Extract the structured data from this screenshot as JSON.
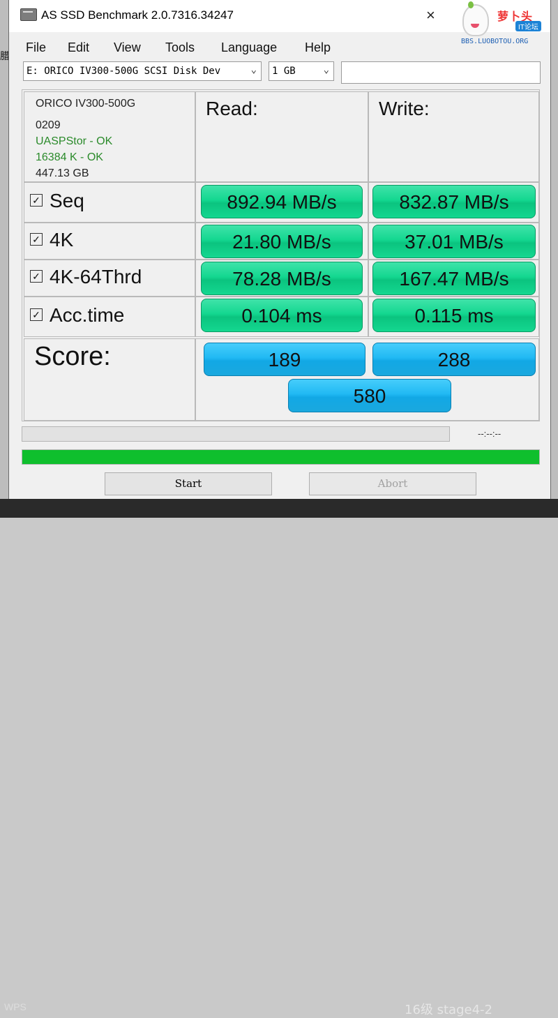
{
  "window": {
    "title": "AS SSD Benchmark 2.0.7316.34247"
  },
  "watermark": {
    "name_cn": "萝卜头",
    "sub_cn": "IT论坛",
    "url": "BBS.LUOBOTOU.ORG"
  },
  "menu": [
    "File",
    "Edit",
    "View",
    "Tools",
    "Language",
    "Help"
  ],
  "drive_select": {
    "value": "E: ORICO IV300-500G SCSI Disk Dev"
  },
  "size_select": {
    "value": "1 GB"
  },
  "drive_info": {
    "model": "ORICO IV300-500G",
    "firmware": "0209",
    "driver": "UASPStor - OK",
    "alignment": "16384 K - OK",
    "capacity": "447.13 GB"
  },
  "headers": {
    "read": "Read:",
    "write": "Write:"
  },
  "rows": [
    {
      "label": "Seq",
      "checked": true,
      "read": "892.94 MB/s",
      "write": "832.87 MB/s"
    },
    {
      "label": "4K",
      "checked": true,
      "read": "21.80 MB/s",
      "write": "37.01 MB/s"
    },
    {
      "label": "4K-64Thrd",
      "checked": true,
      "read": "78.28 MB/s",
      "write": "167.47 MB/s"
    },
    {
      "label": "Acc.time",
      "checked": true,
      "read": "0.104 ms",
      "write": "0.115 ms"
    }
  ],
  "score": {
    "label": "Score:",
    "read": "189",
    "write": "288",
    "total": "580"
  },
  "progress": {
    "time": "--:--:--",
    "overall_fraction": 1.0
  },
  "buttons": {
    "start": "Start",
    "abort": "Abort"
  },
  "background": {
    "taskbar_text": "16级 stage4-2",
    "wps": "WPS"
  },
  "colors": {
    "result_green": "#14d790",
    "score_blue": "#21b9f3",
    "progress_green": "#0fbf2d",
    "driver_ok_green": "#2a8a2a"
  }
}
